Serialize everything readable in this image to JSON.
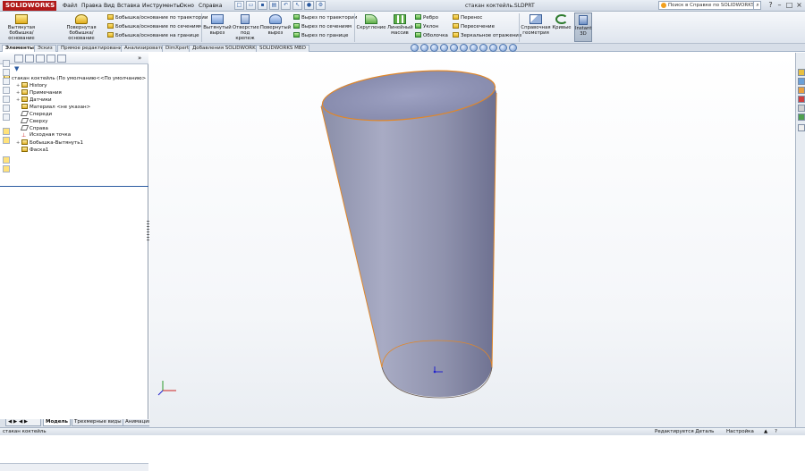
{
  "app": {
    "logo": "SOLIDWORKS",
    "document_title": "стакан коктейль.SLDPRT"
  },
  "menu": [
    "Файл",
    "Правка",
    "Вид",
    "Вставка",
    "Инструменты",
    "Окно",
    "Справка"
  ],
  "help_search": {
    "placeholder": "Поиск в Справке по SOLIDWORKS"
  },
  "ribbon": {
    "extrude_boss": [
      "Вытянутая",
      "бобышка/основание"
    ],
    "revolve_boss": [
      "Повернутая",
      "бобышка/основание"
    ],
    "sweep_boss": "Бобышка/основание по траектории",
    "loft_boss": "Бобышка/основание по сечениям",
    "boundary_boss": "Бобышка/основание на границе",
    "extrude_cut": [
      "Вытянутый",
      "вырез"
    ],
    "hole_wizard": [
      "Отверстие",
      "под",
      "крепеж"
    ],
    "revolve_cut": [
      "Повернутый",
      "вырез"
    ],
    "sweep_cut": "Вырез по траектории",
    "loft_cut": "Вырез по сечениям",
    "boundary_cut": "Вырез по границе",
    "fillet": "Скругление",
    "linear_pattern": [
      "Линейный",
      "массив"
    ],
    "rib": "Ребро",
    "draft": "Уклон",
    "shell": "Оболочка",
    "wrap": "Перенос",
    "intersect": "Пересечение",
    "mirror": "Зеркальное отражение",
    "reference_geometry": [
      "Справочная",
      "геометрия"
    ],
    "curves": "Кривые",
    "instant3d": [
      "Instant",
      "3D"
    ]
  },
  "tabs": [
    "Элементы",
    "Эскиз",
    "Прямое редактирование",
    "Анализировать",
    "DimXpert",
    "Добавления SOLIDWORKS",
    "SOLIDWORKS MBD"
  ],
  "tree": {
    "root": "стакан коктейль  (По умолчанию<<По умолчанию>",
    "items": [
      "History",
      "Примечания",
      "Датчики",
      "Материал <не указан>",
      "Спереди",
      "Сверху",
      "Справа",
      "Исходная точка",
      "Бобышка-Вытянуть1",
      "Фаска1"
    ]
  },
  "bottom_tabs": [
    "Модель",
    "Трехмерные виды",
    "Анимация1"
  ],
  "status": {
    "left": "стакан коктейль",
    "mode": "Редактируется Деталь",
    "custom": "Настройка"
  }
}
